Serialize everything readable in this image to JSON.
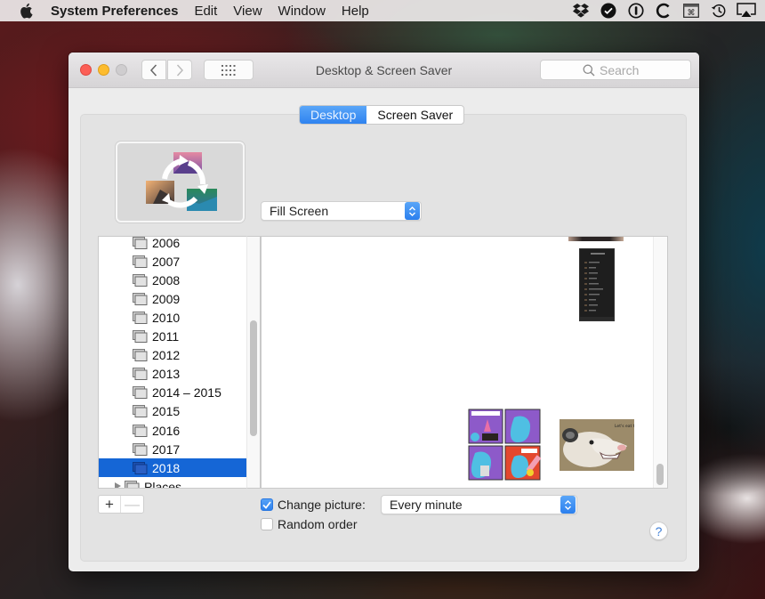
{
  "menubar": {
    "apple_icon": "apple-logo",
    "app_name": "System Preferences",
    "menus": [
      "Edit",
      "View",
      "Window",
      "Help"
    ],
    "status_icons": [
      "dropbox-icon",
      "checkmark-circle-icon",
      "1password-icon",
      "c-app-icon",
      "keyboard-shortcut-icon",
      "time-machine-icon",
      "airplay-icon"
    ]
  },
  "window": {
    "title": "Desktop & Screen Saver",
    "search": {
      "placeholder": "Search",
      "value": ""
    },
    "nav": {
      "back": "‹",
      "forward": "›"
    }
  },
  "tabs": [
    {
      "label": "Desktop",
      "active": true
    },
    {
      "label": "Screen Saver",
      "active": false
    }
  ],
  "fill_mode": {
    "selected": "Fill Screen"
  },
  "sidebar": {
    "items": [
      {
        "label": "2006",
        "selected": false
      },
      {
        "label": "2007",
        "selected": false
      },
      {
        "label": "2008",
        "selected": false
      },
      {
        "label": "2009",
        "selected": false
      },
      {
        "label": "2010",
        "selected": false
      },
      {
        "label": "2011",
        "selected": false
      },
      {
        "label": "2012",
        "selected": false
      },
      {
        "label": "2013",
        "selected": false
      },
      {
        "label": "2014 – 2015",
        "selected": false
      },
      {
        "label": "2015",
        "selected": false
      },
      {
        "label": "2016",
        "selected": false
      },
      {
        "label": "2017",
        "selected": false
      },
      {
        "label": "2018",
        "selected": true
      }
    ],
    "places_label": "Places",
    "add_label": "+",
    "remove_label": "—"
  },
  "images": {
    "comic_caption": "(comic strip)",
    "opossum_caption": "Let's eat trash"
  },
  "change_picture": {
    "label": "Change picture:",
    "checked": true,
    "interval": "Every minute"
  },
  "random_order": {
    "label": "Random order",
    "checked": false
  },
  "help": {
    "label": "?"
  }
}
